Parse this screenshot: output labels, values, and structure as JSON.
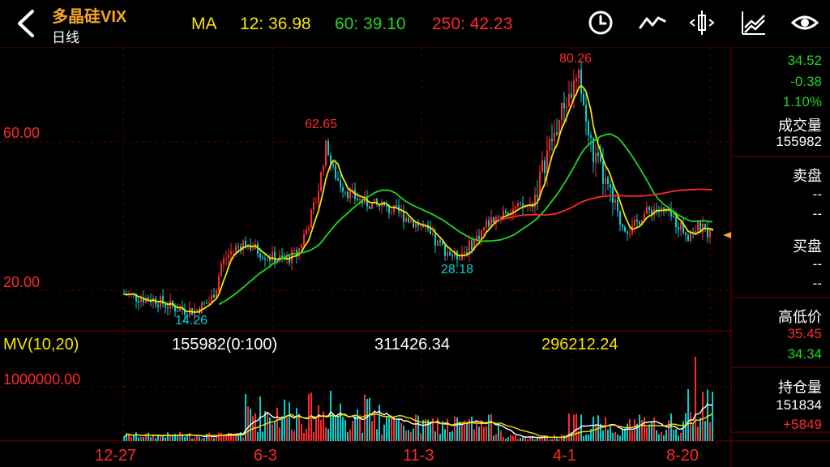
{
  "header": {
    "title": "多晶硅VIX",
    "subtitle": "日线",
    "ma_label": "MA",
    "ma": [
      {
        "text": "12: 36.98",
        "color": "#f5e400"
      },
      {
        "text": "60: 39.10",
        "color": "#22d622"
      },
      {
        "text": "250: 42.23",
        "color": "#ff2a2a"
      }
    ],
    "tools": [
      "clock-icon",
      "line-chart-icon",
      "crosshair-icon",
      "drawing-icon",
      "eye-icon"
    ]
  },
  "main_chart": {
    "y_labels": [
      "60.00",
      "20.00"
    ],
    "annotations": {
      "high1": "62.65",
      "high2": "80.26",
      "low1": "14.26",
      "low2": "28.18"
    }
  },
  "volume_panel": {
    "label": "MV(10,20)",
    "current": "155982(0:100)",
    "mv10": "311426.34",
    "mv20": "296212.24",
    "y_label": "1000000.00"
  },
  "x_labels": [
    "12-27",
    "6-3",
    "11-3",
    "4-1",
    "8-20"
  ],
  "right_panel": {
    "price": "34.52",
    "change": "-0.38",
    "change_pct": "1.10%",
    "volume_label": "成交量",
    "volume": "155982",
    "sell_label": "卖盘",
    "sell_1": "--",
    "sell_2": "--",
    "buy_label": "买盘",
    "buy_1": "--",
    "buy_2": "--",
    "hilo_label": "高低价",
    "high": "35.45",
    "low": "34.34",
    "oi_label": "持仓量",
    "oi": "151834",
    "oi_change": "+5849"
  },
  "colors": {
    "up": "#ff2a2a",
    "down": "#00d2d2",
    "ma12": "#f5e400",
    "ma60": "#22d622",
    "ma250": "#ff2a2a",
    "title": "#f5a623"
  },
  "chart_data": {
    "type": "candlestick",
    "x_axis_labels": [
      "12-27",
      "6-3",
      "11-3",
      "4-1",
      "8-20"
    ],
    "y_axis_labels": [
      "60.00",
      "20.00"
    ],
    "approx_close_path": [
      [
        0,
        19
      ],
      [
        20,
        18
      ],
      [
        35,
        15
      ],
      [
        50,
        21
      ],
      [
        65,
        33
      ],
      [
        85,
        30
      ],
      [
        100,
        27
      ],
      [
        115,
        33
      ],
      [
        125,
        47
      ],
      [
        135,
        49
      ],
      [
        150,
        45
      ],
      [
        170,
        43
      ],
      [
        190,
        42
      ],
      [
        210,
        38
      ],
      [
        230,
        34
      ],
      [
        245,
        30
      ],
      [
        255,
        34
      ],
      [
        265,
        45
      ],
      [
        275,
        42
      ],
      [
        285,
        66
      ],
      [
        295,
        72
      ],
      [
        305,
        62
      ],
      [
        315,
        54
      ],
      [
        330,
        40
      ],
      [
        345,
        43
      ],
      [
        365,
        41
      ],
      [
        375,
        38
      ],
      [
        385,
        36
      ]
    ],
    "annotations": [
      {
        "label": "62.65",
        "type": "high"
      },
      {
        "label": "80.26",
        "type": "high"
      },
      {
        "label": "14.26",
        "type": "low"
      },
      {
        "label": "28.18",
        "type": "low"
      }
    ],
    "volume": {
      "mv10": 311426.34,
      "mv20": 296212.24,
      "current": 155982
    }
  }
}
